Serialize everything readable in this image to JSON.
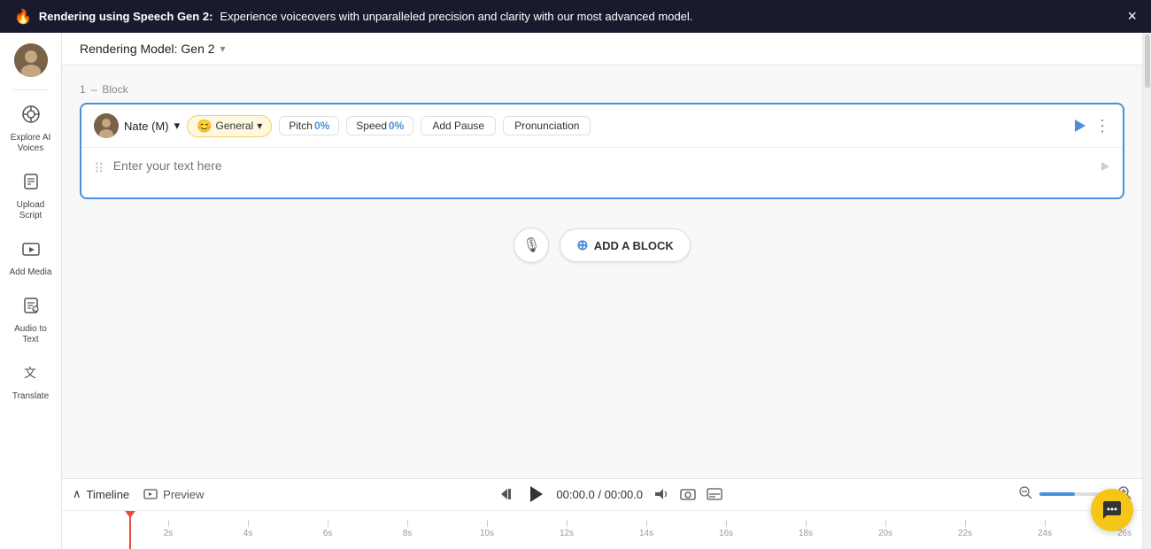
{
  "banner": {
    "icon": "🔥",
    "title": "Rendering using Speech Gen 2:",
    "description": "Experience voiceovers with unparalleled precision and clarity with our most advanced model.",
    "close_label": "×"
  },
  "header": {
    "model_label": "Rendering Model: Gen 2",
    "chevron": "▾"
  },
  "sidebar": {
    "avatar_alt": "User avatar",
    "items": [
      {
        "id": "explore-ai",
        "label": "Explore AI\nVoices",
        "icon": "⊞"
      },
      {
        "id": "upload-script",
        "label": "Upload\nScript",
        "icon": "⬆"
      },
      {
        "id": "add-media",
        "label": "Add Media",
        "icon": "🎬"
      },
      {
        "id": "audio-to-text",
        "label": "Audio to\nText",
        "icon": "🔤"
      },
      {
        "id": "translate",
        "label": "Translate",
        "icon": "翻"
      }
    ]
  },
  "block": {
    "number": "1",
    "dash": "–",
    "type_label": "Block",
    "voice_name": "Nate (M)",
    "voice_chevron": "▾",
    "tag_emoji": "😊",
    "tag_label": "General",
    "tag_chevron": "▾",
    "pitch_label": "Pitch",
    "pitch_value": "0%",
    "speed_label": "Speed",
    "speed_value": "0%",
    "add_pause_label": "Add Pause",
    "pronunciation_label": "Pronunciation",
    "text_placeholder": "Enter your text here",
    "play_icon": "▶",
    "more_icon": "⋮",
    "drag_icon": "⠿"
  },
  "add_block": {
    "mic_icon": "🎙",
    "add_label": "ADD A BLOCK",
    "plus_icon": "⊕"
  },
  "timeline": {
    "timeline_label": "Timeline",
    "collapse_icon": "∧",
    "preview_label": "Preview",
    "preview_icon": "⊡",
    "rewind_icon": "⏮",
    "play_icon": "▶",
    "time_current": "00:00.0",
    "time_separator": "/",
    "time_total": "00:00.0",
    "volume_icon": "🔊",
    "camera_icon": "🎬",
    "subtitle_icon": "⊟",
    "zoom_in_icon": "🔍+",
    "zoom_out_icon": "🔍-",
    "ruler_marks": [
      "2s",
      "4s",
      "6s",
      "8s",
      "10s",
      "12s",
      "14s",
      "16s",
      "18s",
      "20s",
      "22s",
      "24s",
      "26s"
    ]
  },
  "chat": {
    "icon": "💬"
  }
}
